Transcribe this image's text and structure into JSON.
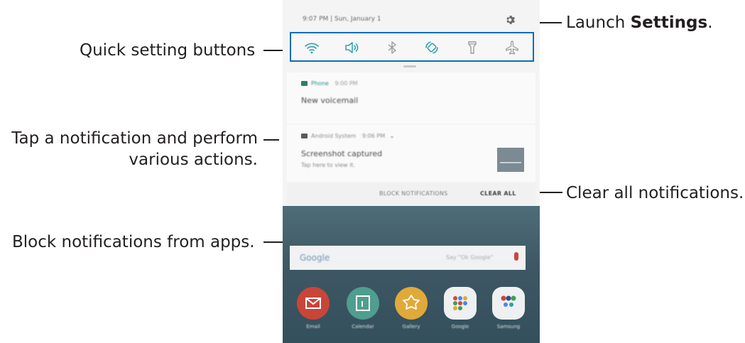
{
  "callouts": {
    "settings_prefix": "Launch ",
    "settings_bold": "Settings",
    "settings_suffix": ".",
    "quick_settings": "Quick setting buttons",
    "tap_line1": "Tap a notification and perform",
    "tap_line2": "various actions.",
    "clear_all": "Clear all notifications.",
    "block": "Block notifications from apps."
  },
  "panel": {
    "status_text": "9:07 PM  |  Sun, January 1",
    "quick_settings": [
      {
        "icon": "wifi-icon",
        "active": true
      },
      {
        "icon": "sound-icon",
        "active": true
      },
      {
        "icon": "bluetooth-icon",
        "active": false
      },
      {
        "icon": "auto-rotate-icon",
        "active": true
      },
      {
        "icon": "flashlight-icon",
        "active": false
      },
      {
        "icon": "airplane-mode-icon",
        "active": false
      }
    ],
    "notifications": [
      {
        "app": "Phone",
        "time": "9:00 PM",
        "title": "New voicemail",
        "subtitle": ""
      },
      {
        "app": "Android System",
        "time": "9:06 PM",
        "title": "Screenshot captured",
        "subtitle": "Tap here to view it."
      }
    ],
    "actions": {
      "block": "BLOCK NOTIFICATIONS",
      "clear": "CLEAR ALL"
    }
  },
  "home": {
    "search_logo": "Google",
    "search_hint": "Say \"Ok Google\"",
    "apps": [
      {
        "label": "Email",
        "icon": "email-icon",
        "color": "#c9453a"
      },
      {
        "label": "Calendar",
        "icon": "calendar-icon",
        "color": "#4f9e90"
      },
      {
        "label": "Gallery",
        "icon": "gallery-icon",
        "color": "#e1a93a"
      },
      {
        "label": "Google",
        "icon": "google-folder-icon",
        "color": "#eef0f1"
      },
      {
        "label": "Samsung",
        "icon": "samsung-folder-icon",
        "color": "#eef0f1"
      }
    ]
  },
  "colors": {
    "highlight_border": "#0a6fb3",
    "callout_text": "#231f20",
    "accent": "#2b8a8a"
  }
}
